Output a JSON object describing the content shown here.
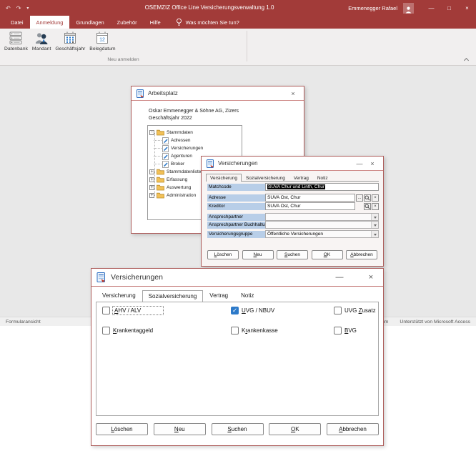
{
  "app": {
    "titlebar": {
      "title": "OSEMZIZ Office Line Versicherungsverwaltung 1.0",
      "user": "Emmenegger Rafael",
      "quick_access": {
        "undo": "↶",
        "redo": "↷",
        "customize": "▾"
      },
      "window_controls": {
        "minimize": "—",
        "maximize": "□",
        "close": "×"
      }
    },
    "ribbon": {
      "tabs": [
        {
          "label": "Datei",
          "active": false
        },
        {
          "label": "Anmeldung",
          "active": true
        },
        {
          "label": "Grundlagen",
          "active": false
        },
        {
          "label": "Zubehör",
          "active": false
        },
        {
          "label": "Hilfe",
          "active": false
        }
      ],
      "tellme": "Was möchten Sie tun?",
      "buttons": [
        {
          "label": "Datenbank",
          "icon": "database-icon"
        },
        {
          "label": "Mandant",
          "icon": "users-icon"
        },
        {
          "label": "Geschäftsjahr",
          "icon": "calendar-grid-icon"
        },
        {
          "label": "Belegdatum",
          "icon": "calendar-12-icon",
          "day": "12"
        }
      ],
      "group_label": "Neu anmelden"
    },
    "statusbar": {
      "left": "Formularansicht",
      "num_lock": "Num",
      "right": "Unterstützt von Microsoft Access"
    }
  },
  "arbeitsplatz_window": {
    "title": "Arbeitsplatz",
    "close": "×",
    "company": "Oskar Emmenegger & Söhne AG, Zizers",
    "fiscal_year": "Geschäftsjahr 2022",
    "tree_items": [
      {
        "label": "Stammdaten",
        "level": 0,
        "state": "-",
        "type": "folder"
      },
      {
        "label": "Adressen",
        "level": 1,
        "type": "form"
      },
      {
        "label": "Versicherungen",
        "level": 1,
        "type": "form"
      },
      {
        "label": "Agenturen",
        "level": 1,
        "type": "form"
      },
      {
        "label": "Broker",
        "level": 1,
        "type": "form"
      },
      {
        "label": "Stammdatenlisten",
        "level": 0,
        "state": "+",
        "type": "folder"
      },
      {
        "label": "Erfassung",
        "level": 0,
        "state": "+",
        "type": "folder"
      },
      {
        "label": "Auswertung",
        "level": 0,
        "state": "+",
        "type": "folder"
      },
      {
        "label": "Administration",
        "level": 0,
        "state": "+",
        "type": "folder"
      }
    ]
  },
  "versicherung_window": {
    "title": "Versicherungen",
    "controls": {
      "minimize": "—",
      "close": "×"
    },
    "tabs": [
      {
        "label": "Versicherung",
        "active": true
      },
      {
        "label": "Sozialversicherung",
        "active": false
      },
      {
        "label": "Vertrag",
        "active": false
      },
      {
        "label": "Notiz",
        "active": false
      }
    ],
    "fields": [
      {
        "label": "Matchcode",
        "value": "SUVA Chur und Linth, Chur",
        "selected": true
      },
      {
        "label": "Adresse",
        "value": "SUVA Ost, Chur"
      },
      {
        "label": "Kreditor",
        "value": "SUVA Ost, Chur"
      },
      {
        "label": "Ansprechpartner",
        "value": ""
      },
      {
        "label": "Ansprechpartner Buchhaltung",
        "value": ""
      },
      {
        "label": "Versicherungsgruppe",
        "value": "Öffentliche Versicherungen"
      }
    ],
    "field_buttons": {
      "browse": "...",
      "clear": "×"
    },
    "buttons": [
      {
        "label": "Löschen",
        "accel": "L"
      },
      {
        "label": "Neu",
        "accel": "N"
      },
      {
        "label": "Suchen",
        "accel": "S"
      },
      {
        "label": "OK",
        "accel": "O"
      },
      {
        "label": "Abbrechen",
        "accel": "A"
      }
    ]
  },
  "sozial_window": {
    "title": "Versicherungen",
    "controls": {
      "minimize": "—",
      "close": "×"
    },
    "tabs": [
      {
        "label": "Versicherung",
        "active": false
      },
      {
        "label": "Sozialversicherung",
        "active": true
      },
      {
        "label": "Vertrag",
        "active": false
      },
      {
        "label": "Notiz",
        "active": false
      }
    ],
    "checkboxes": [
      {
        "label": "AHV / ALV",
        "accel": "A",
        "checked": false
      },
      {
        "label": "UVG / NBUV",
        "accel": "U",
        "checked": true
      },
      {
        "label": "UVG Zusatz",
        "accel": "Z",
        "checked": false
      },
      {
        "label": "Krankentaggeld",
        "accel": "K",
        "checked": false
      },
      {
        "label": "Krankenkasse",
        "accel": "r",
        "checked": false
      },
      {
        "label": "BVG",
        "accel": "B",
        "checked": false
      }
    ],
    "buttons": [
      {
        "label": "Löschen",
        "accel": "L"
      },
      {
        "label": "Neu",
        "accel": "N"
      },
      {
        "label": "Suchen",
        "accel": "S"
      },
      {
        "label": "OK",
        "accel": "O"
      },
      {
        "label": "Abbrechen",
        "accel": "A"
      }
    ]
  }
}
